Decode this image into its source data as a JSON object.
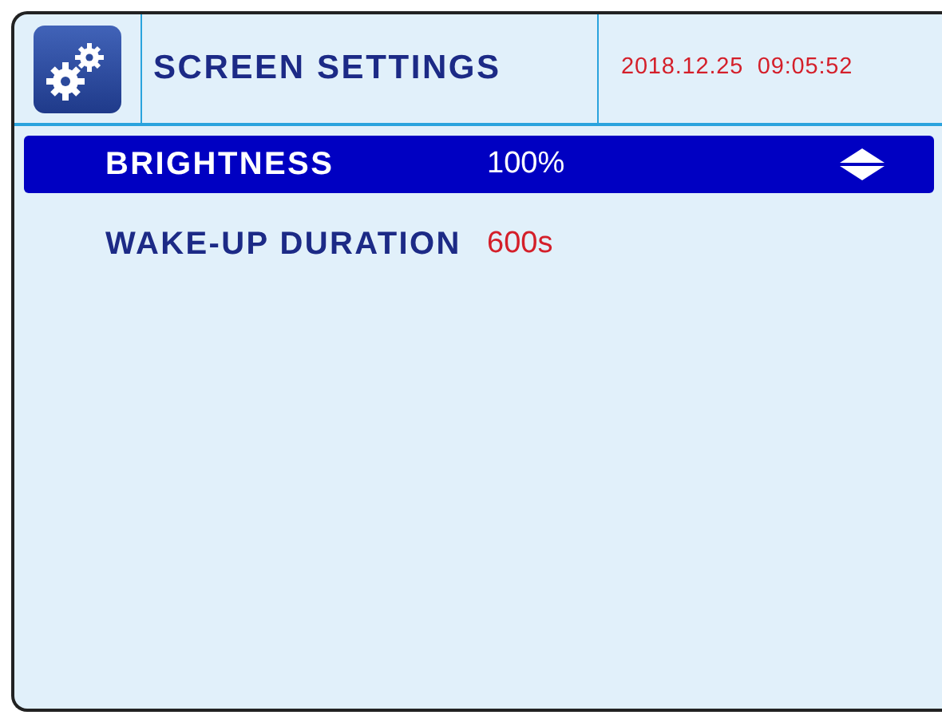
{
  "header": {
    "title": "SCREEN SETTINGS",
    "datetime": "2018.12.25  09:05:52"
  },
  "settings": [
    {
      "label": "BRIGHTNESS",
      "value": "100%",
      "selected": true
    },
    {
      "label": "WAKE-UP DURATION",
      "value": "600s",
      "selected": false
    }
  ]
}
